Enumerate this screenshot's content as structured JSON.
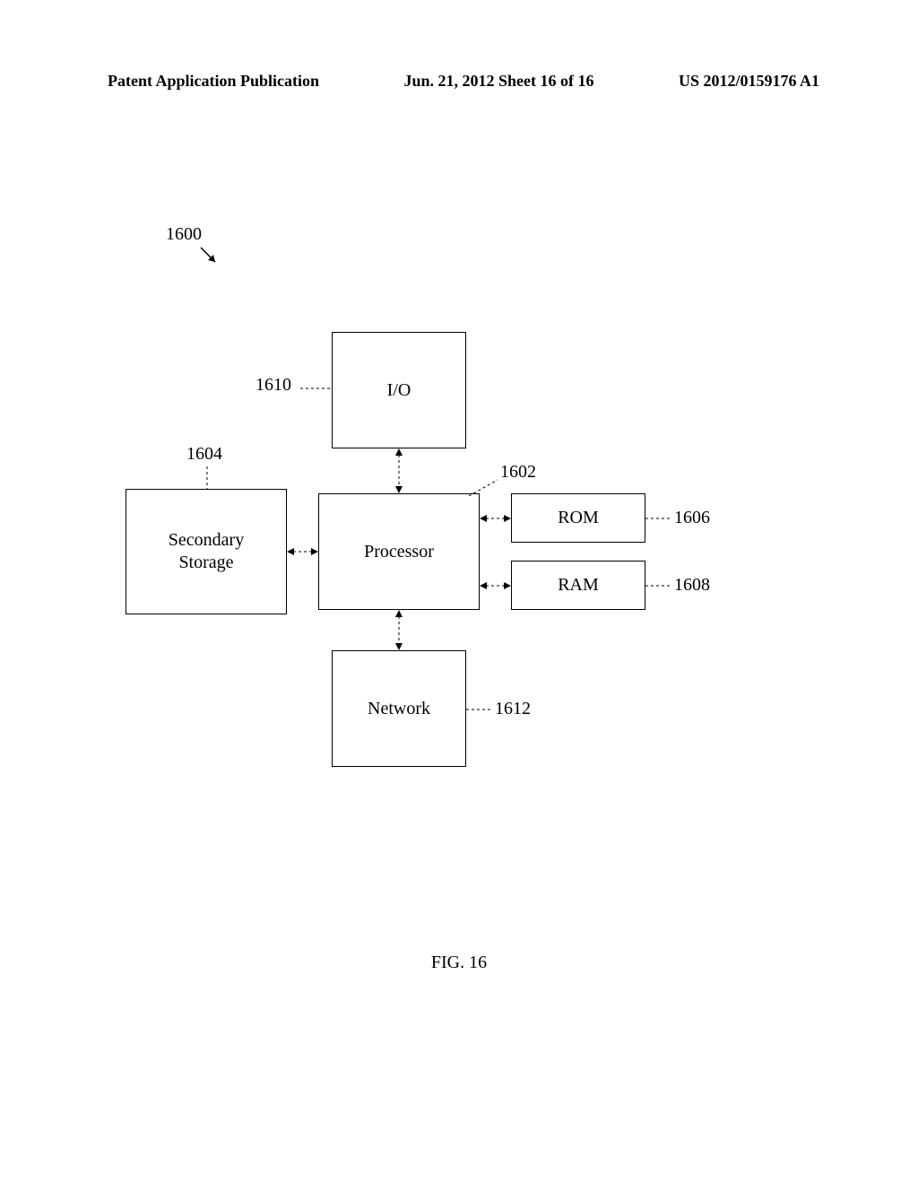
{
  "header": {
    "left": "Patent Application Publication",
    "center": "Jun. 21, 2012  Sheet 16 of 16",
    "right": "US 2012/0159176 A1"
  },
  "refs": {
    "system": "1600",
    "processor": "1602",
    "secondary": "1604",
    "rom": "1606",
    "ram": "1608",
    "io": "1610",
    "network": "1612"
  },
  "blocks": {
    "io": "I/O",
    "processor": "Processor",
    "secondary_l1": "Secondary",
    "secondary_l2": "Storage",
    "rom": "ROM",
    "ram": "RAM",
    "network": "Network"
  },
  "caption": "FIG. 16"
}
